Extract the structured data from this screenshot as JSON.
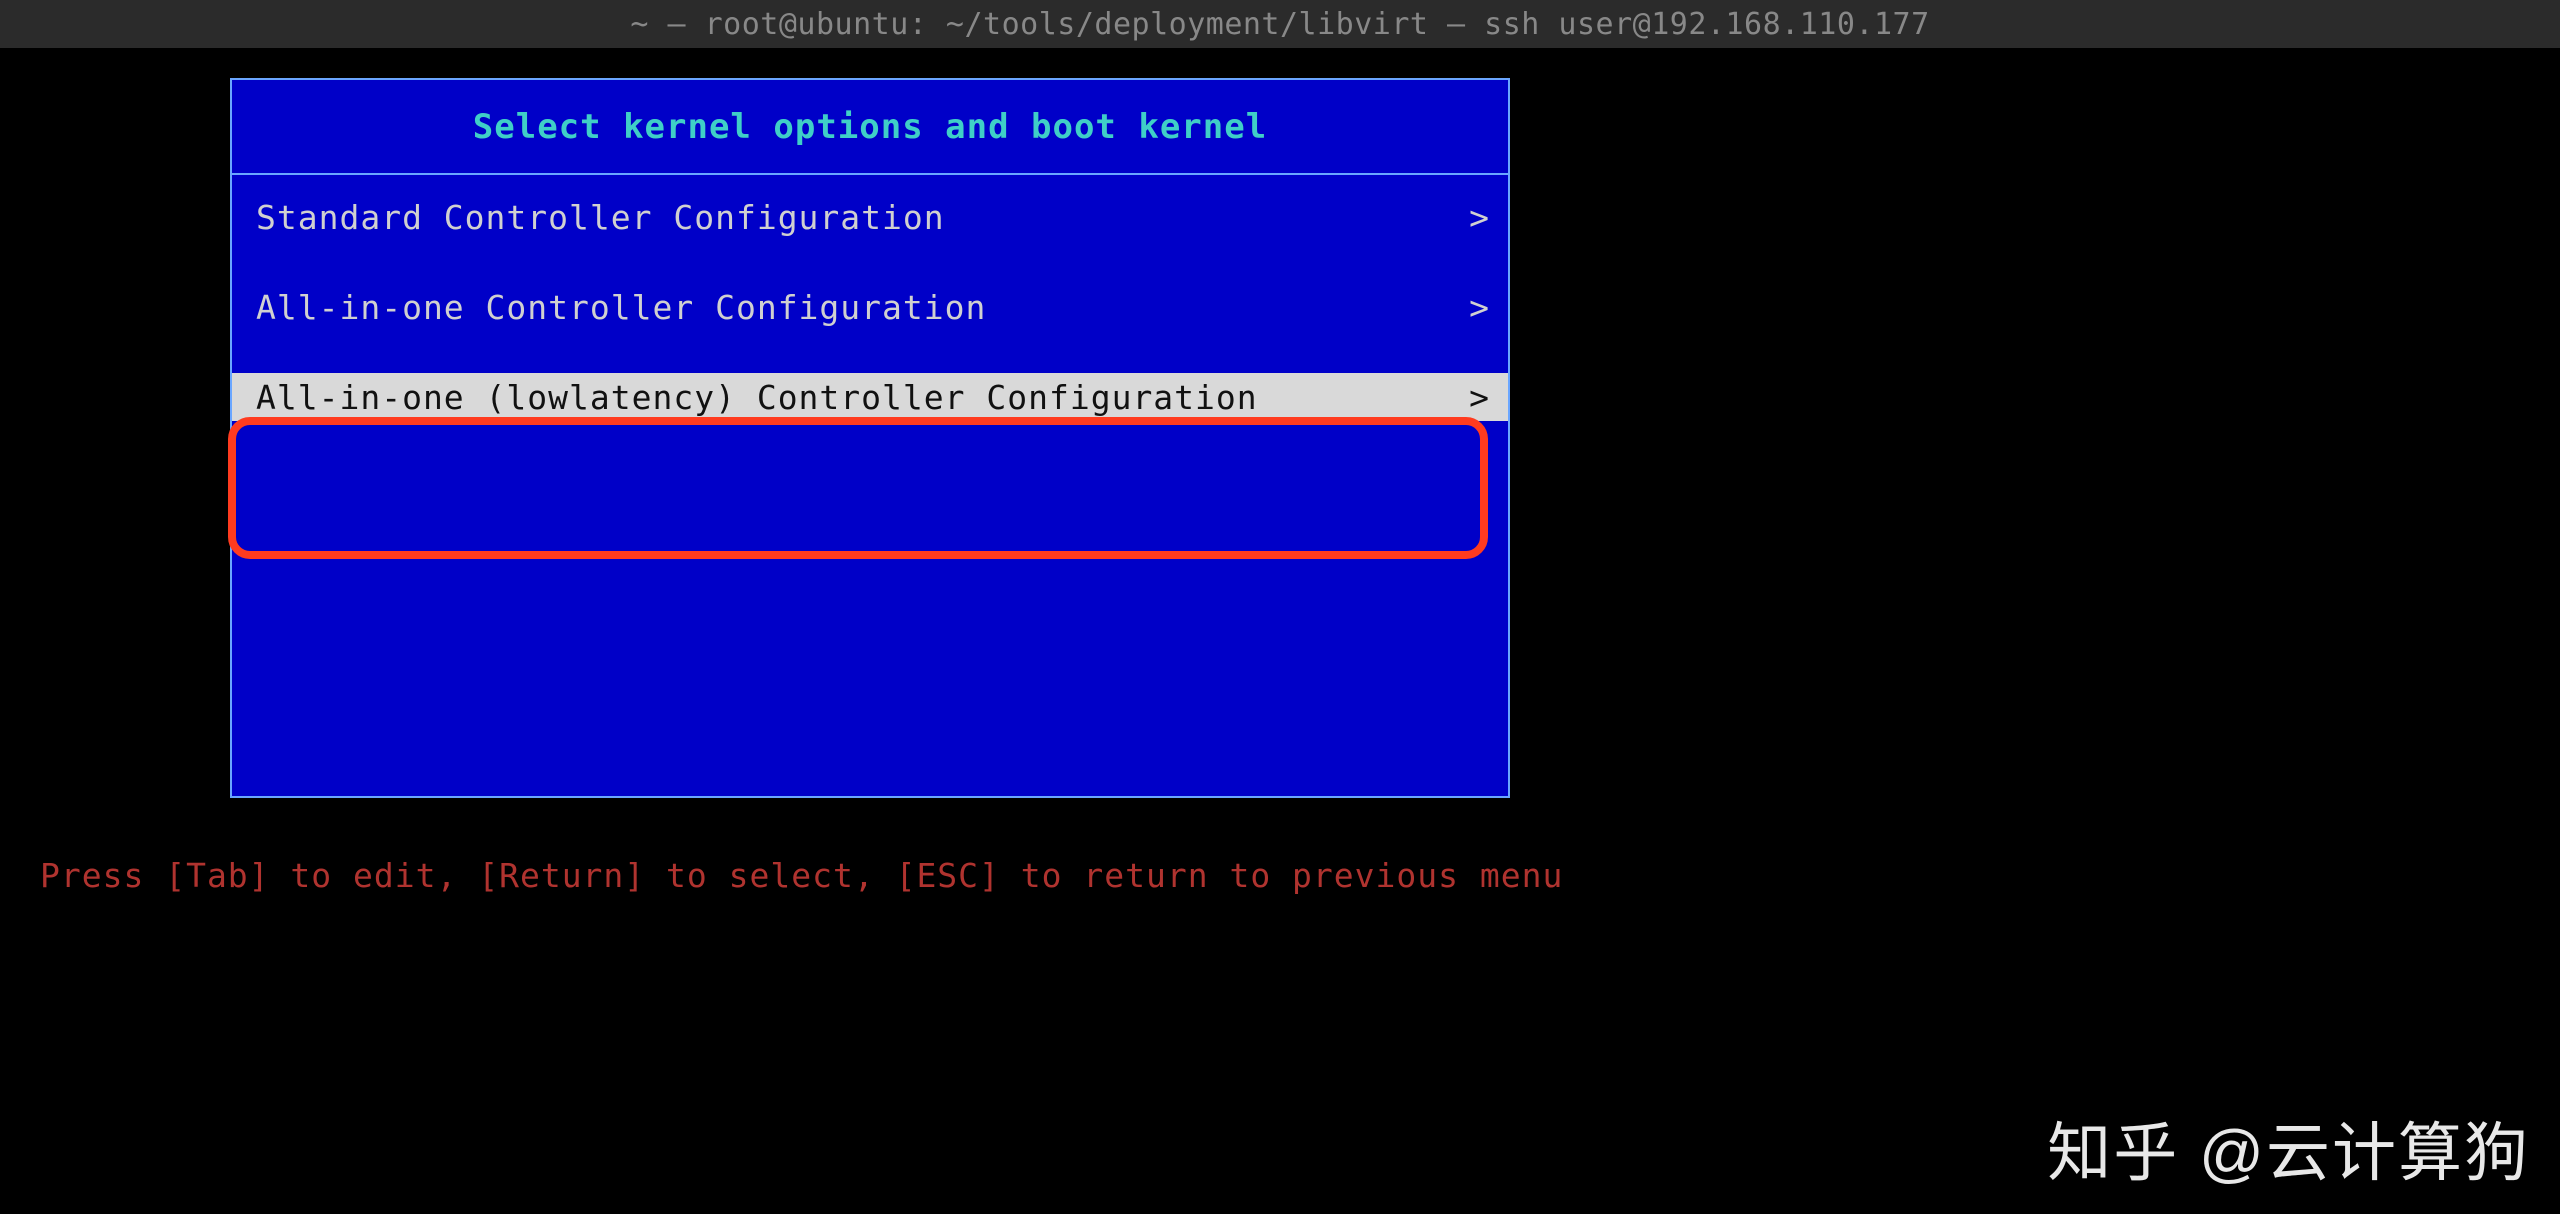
{
  "titlebar": {
    "text": "~ — root@ubuntu: ~/tools/deployment/libvirt — ssh user@192.168.110.177"
  },
  "panel": {
    "title": "Select kernel options and boot kernel"
  },
  "items": [
    {
      "label": "Standard Controller Configuration",
      "arrow": ">",
      "selected": false
    },
    {
      "label": "All-in-one Controller Configuration",
      "arrow": ">",
      "selected": false
    },
    {
      "label": "All-in-one (lowlatency) Controller Configuration",
      "arrow": ">",
      "selected": true
    }
  ],
  "hint": "Press [Tab] to edit, [Return] to select, [ESC] to return to previous menu",
  "watermark": "知乎 @云计算狗"
}
